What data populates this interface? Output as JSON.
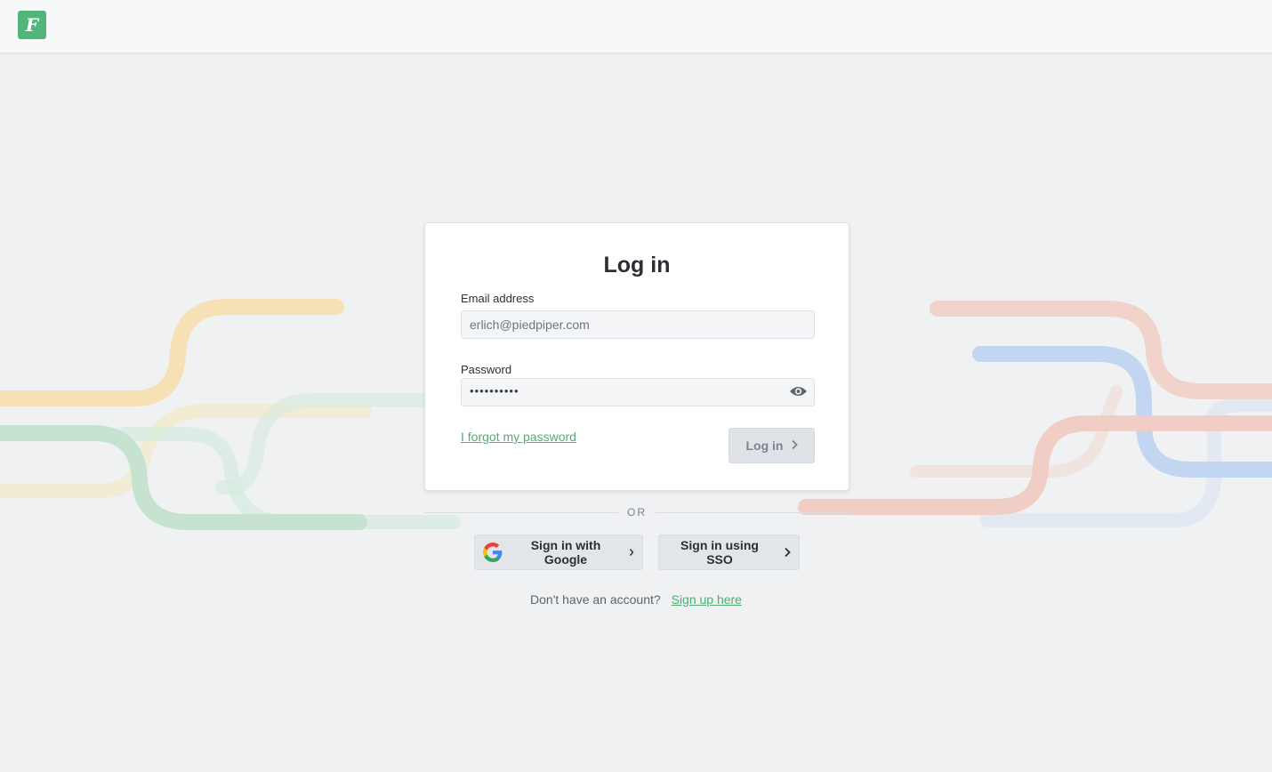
{
  "app": {
    "logo_letter": "F"
  },
  "login": {
    "title": "Log in",
    "email_label": "Email address",
    "email_placeholder": "erlich@piedpiper.com",
    "password_label": "Password",
    "password_mask": "••••••••••",
    "forgot_link": "I forgot my password",
    "submit_label": "Log in"
  },
  "divider": {
    "text": "OR"
  },
  "alt_signin": {
    "google_label": "Sign in with Google",
    "sso_label": "Sign in using SSO"
  },
  "signup": {
    "prompt": "Don't have an account?",
    "link": "Sign up here"
  },
  "colors": {
    "brand_green": "#52b67a",
    "link_green": "#4fae73",
    "page_bg": "#eff1f3"
  },
  "icons": {
    "logo": "brand-logo-icon",
    "eye": "eye-icon",
    "chevron": "chevron-right-icon",
    "google": "google-g-icon"
  }
}
